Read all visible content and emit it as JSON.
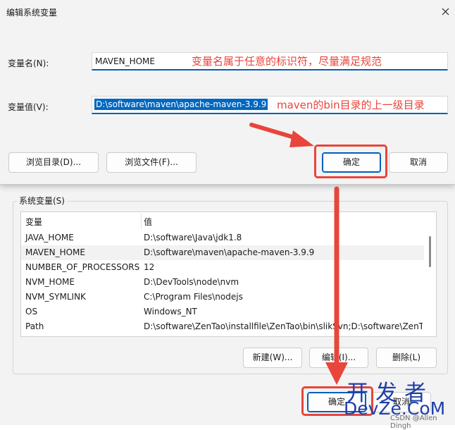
{
  "dialog": {
    "title": "编辑系统变量",
    "name_label": "变量名(N):",
    "name_value": "MAVEN_HOME",
    "value_label": "变量值(V):",
    "value_value": "D:\\software\\maven\\apache-maven-3.9.9",
    "browse_dir_label": "浏览目录(D)...",
    "browse_file_label": "浏览文件(F)...",
    "ok_label": "确定",
    "cancel_label": "取消"
  },
  "annotations": {
    "name_hint": "变量名属于任意的标识符，尽量满足规范",
    "value_hint": "maven的bin目录的上一级目录",
    "color": "#e8453c"
  },
  "system_vars": {
    "group_label": "系统变量(S)",
    "columns": [
      "变量",
      "值"
    ],
    "rows": [
      {
        "name": "JAVA_HOME",
        "value": "D:\\software\\Java\\jdk1.8"
      },
      {
        "name": "MAVEN_HOME",
        "value": "D:\\software\\maven\\apache-maven-3.9.9"
      },
      {
        "name": "NUMBER_OF_PROCESSORS",
        "value": "12"
      },
      {
        "name": "NVM_HOME",
        "value": "D:\\DevTools\\node\\nvm"
      },
      {
        "name": "NVM_SYMLINK",
        "value": "C:\\Program Files\\nodejs"
      },
      {
        "name": "OS",
        "value": "Windows_NT"
      },
      {
        "name": "Path",
        "value": "D:\\software\\ZenTao\\installfile\\ZenTao\\bin\\slikSvn;D:\\software\\ZenTao"
      }
    ],
    "new_label": "新建(W)...",
    "edit_label": "编辑(I)...",
    "delete_label": "删除(L)"
  },
  "main_buttons": {
    "ok_label": "确定",
    "cancel_label": "取消"
  },
  "watermark": {
    "cn": "开发者",
    "en": "DevZe.CoM",
    "csdn": "CSDN @Allen Dingh"
  },
  "colors": {
    "accent": "#005fb8",
    "selection": "#0067c0",
    "annotation_red": "#e8453c",
    "watermark_blue": "#1f3fa8"
  }
}
